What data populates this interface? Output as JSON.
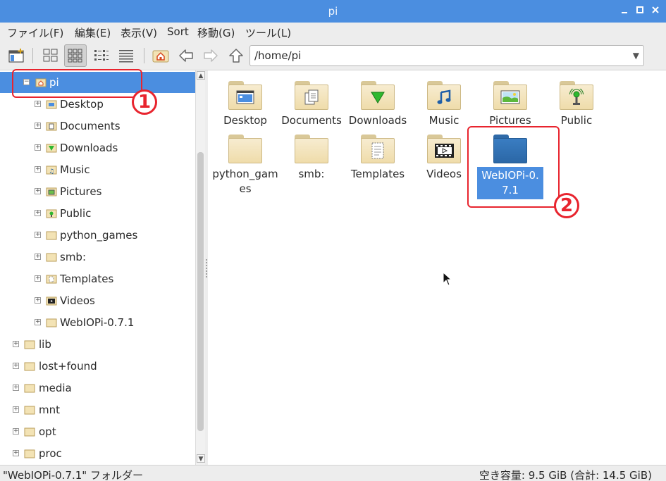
{
  "window": {
    "title": "pi"
  },
  "menu": {
    "file": "ファイル(F)",
    "edit": "編集(E)",
    "view": "表示(V)",
    "sort": "Sort",
    "go": "移動(G)",
    "tools": "ツール(L)"
  },
  "toolbar": {
    "path": "/home/pi"
  },
  "tree": {
    "root": "pi",
    "children": [
      "Desktop",
      "Documents",
      "Downloads",
      "Music",
      "Pictures",
      "Public",
      "python_games",
      "smb:",
      "Templates",
      "Videos",
      "WebIOPi-0.7.1"
    ],
    "siblings": [
      "lib",
      "lost+found",
      "media",
      "mnt",
      "opt",
      "proc"
    ]
  },
  "items": {
    "desktop": "Desktop",
    "documents": "Documents",
    "downloads": "Downloads",
    "music": "Music",
    "pictures": "Pictures",
    "public": "Public",
    "python_games": "python_gam\nes",
    "smb": "smb:",
    "templates": "Templates",
    "videos": "Videos",
    "webiopi": "WebIOPi-0.\n7.1"
  },
  "annotations": {
    "one": "1",
    "two": "2"
  },
  "status": {
    "left": "\"WebIOPi-0.7.1\" フォルダー",
    "right": "空き容量: 9.5 GiB (合計: 14.5 GiB)"
  },
  "colors": {
    "accent": "#4b8ee0",
    "annotation": "#e8242e",
    "folder": "#efdcaa"
  }
}
